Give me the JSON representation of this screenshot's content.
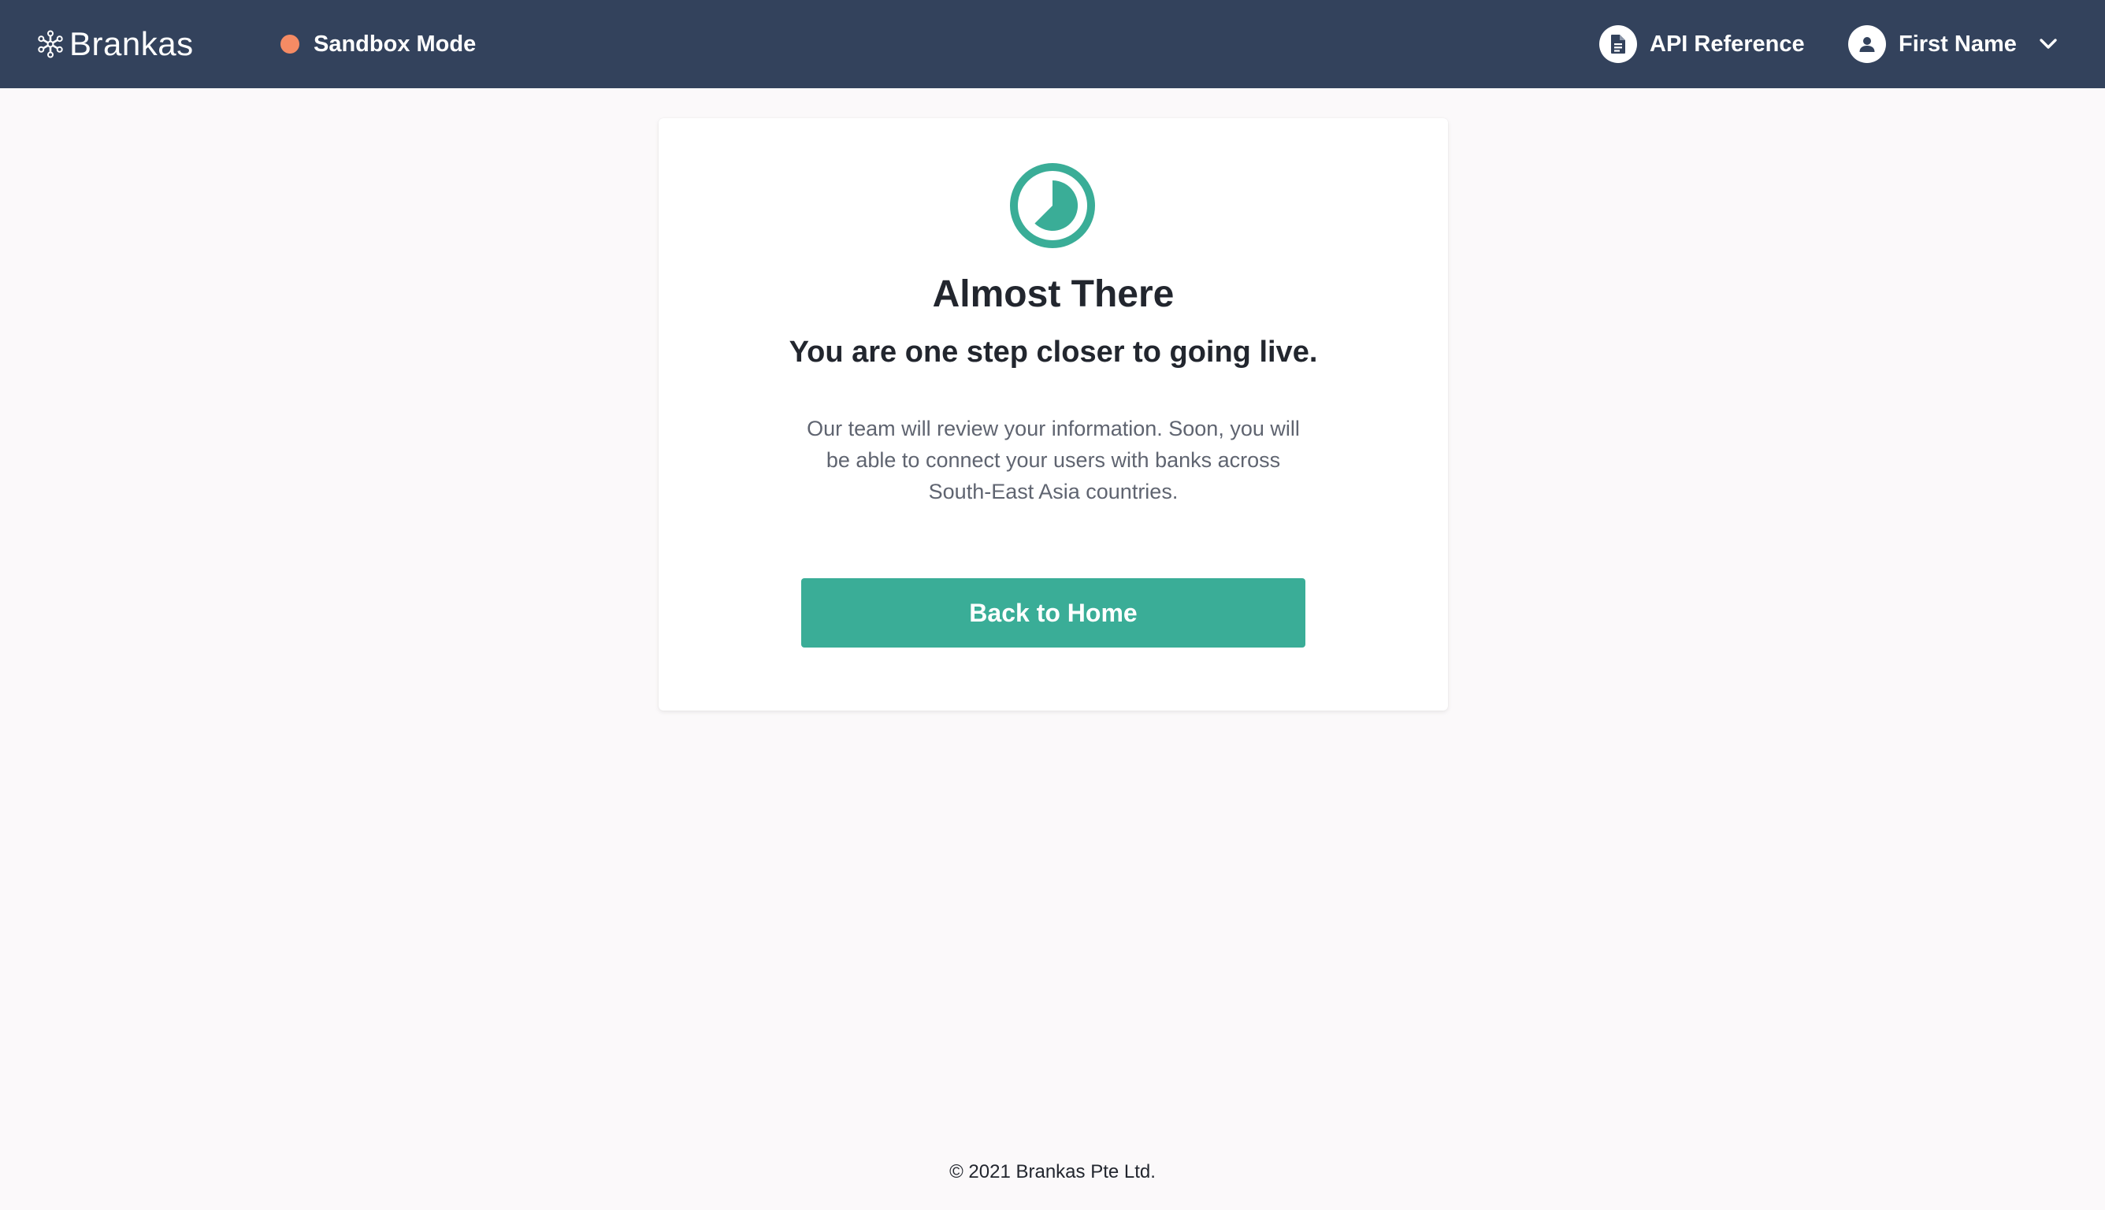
{
  "header": {
    "brand_name": "Brankas",
    "brand_icon": "snowflake-logo-icon",
    "sandbox": {
      "label": "Sandbox Mode",
      "indicator_color": "#f58b64"
    },
    "api_reference": {
      "label": "API Reference",
      "icon": "document-icon"
    },
    "user": {
      "label": "First Name",
      "icon": "user-avatar-icon",
      "dropdown_icon": "chevron-down-icon"
    }
  },
  "card": {
    "status_icon": "clock-pending-icon",
    "title": "Almost There",
    "subtitle": "You are one step closer to going live.",
    "description": "Our team will review your information. Soon, you will be able to connect your users with banks across South-East Asia countries.",
    "button_label": "Back to Home"
  },
  "footer": {
    "copyright": "© 2021 Brankas Pte Ltd."
  },
  "colors": {
    "header_bg": "#33425c",
    "accent": "#3aad97",
    "page_bg": "#fbf9fa",
    "heading_text": "#22262e",
    "body_text": "#5f6470"
  }
}
